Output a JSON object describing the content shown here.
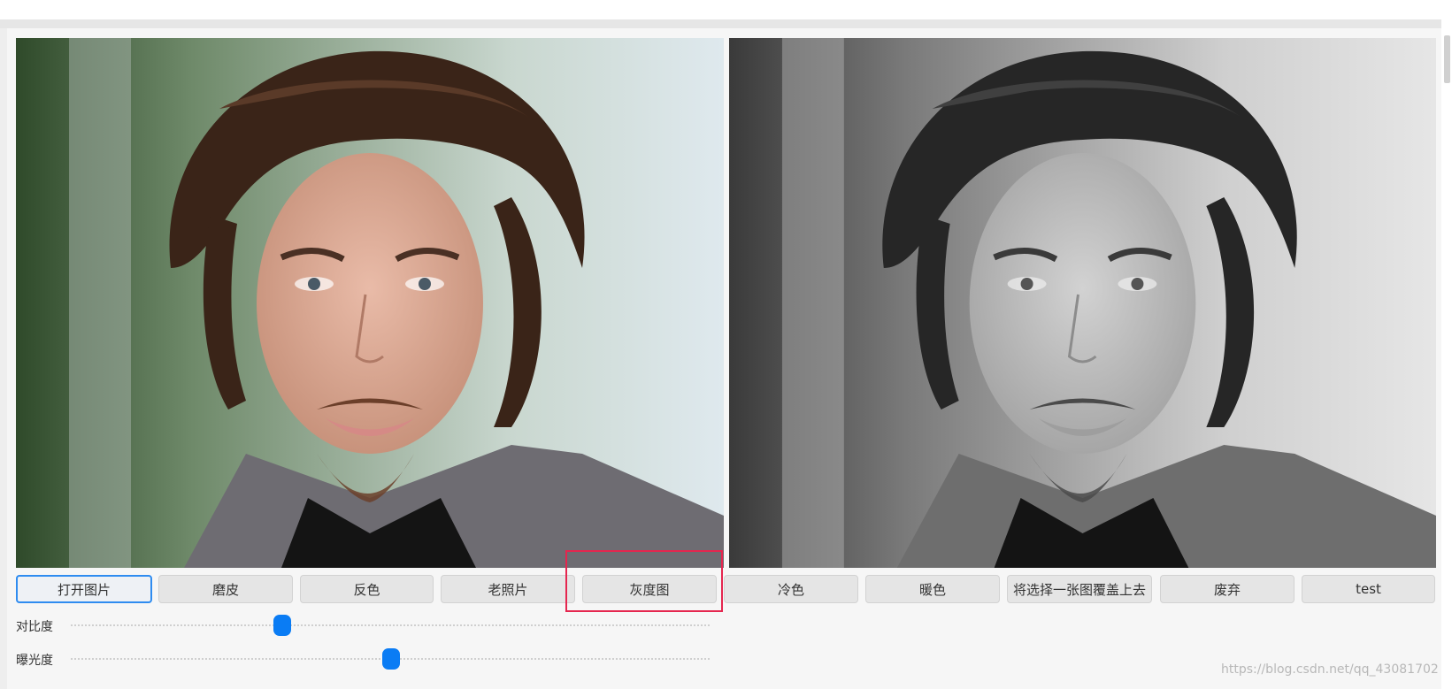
{
  "images": {
    "original_alt": "original-photo",
    "processed_alt": "grayscale-photo"
  },
  "toolbar": {
    "buttons": [
      {
        "label": "打开图片"
      },
      {
        "label": "磨皮"
      },
      {
        "label": "反色"
      },
      {
        "label": "老照片"
      },
      {
        "label": "灰度图"
      },
      {
        "label": "冷色"
      },
      {
        "label": "暖色"
      },
      {
        "label": "将选择一张图覆盖上去"
      },
      {
        "label": "废弃"
      },
      {
        "label": "test"
      }
    ],
    "highlighted": "灰度图"
  },
  "sliders": {
    "contrast": {
      "label": "对比度",
      "value": 0.33
    },
    "exposure": {
      "label": "曝光度",
      "value": 0.5
    }
  },
  "watermark": "https://blog.csdn.net/qq_43081702",
  "colors": {
    "accent": "#0a7cf4",
    "highlight": "#e5264f"
  }
}
